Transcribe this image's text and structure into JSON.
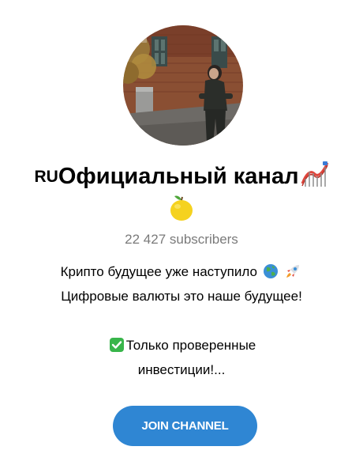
{
  "channel": {
    "title_prefix": "RU",
    "title": "Официальный канал",
    "title_emoji_icon": "roller-coaster-icon",
    "second_line_emoji_icon": "lemon-icon",
    "subscribers": "22 427 subscribers",
    "description": {
      "line1": "Крипто будущее уже наступило",
      "line1_icons": [
        "globe-icon",
        "rocket-icon"
      ],
      "line2": "Цифровые валюты это наше будущее!",
      "line3_icon": "check-mark-button-icon",
      "line3": "Только проверенные",
      "line4": "инвестиции!..."
    }
  },
  "join_button": {
    "label": "JOIN CHANNEL",
    "color": "#2f86d3"
  },
  "colors": {
    "subscribers_text": "#7a7a7a",
    "background": "#ffffff"
  }
}
